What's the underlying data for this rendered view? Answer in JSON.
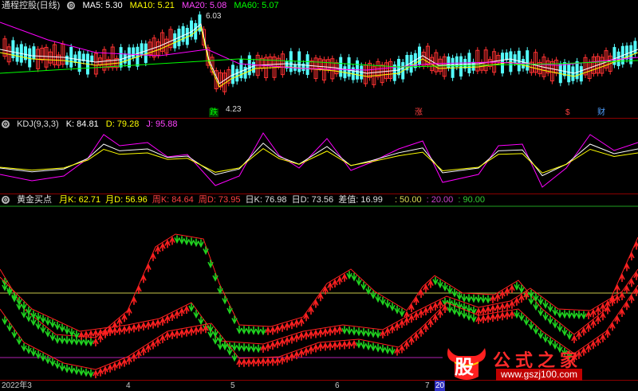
{
  "header_main": {
    "title": "通程控股(日线)",
    "ma5": "MA5: 5.30",
    "ma10": "MA10: 5.21",
    "ma20": "MA20: 5.08",
    "ma60": "MA60: 5.07"
  },
  "header_kdj": {
    "name": "KDJ(9,3,3)",
    "k": "K: 84.81",
    "d": "D: 79.28",
    "j": "J: 95.88"
  },
  "header_gold": {
    "name": "黄金买点",
    "mk": "月K: 62.71",
    "md": "月D: 56.96",
    "wk": "周K: 84.64",
    "wd": "周D: 73.95",
    "dk": "日K: 76.98",
    "dd": "日D: 73.56",
    "diff": "差值: 16.99",
    "l50": ": 50.00",
    "l20": ": 20.00",
    "l90": ": 90.00"
  },
  "annotations": {
    "high": "6.03",
    "low": "4.23",
    "die": "跌",
    "zhang": "涨",
    "s": "$",
    "cai": "财"
  },
  "xaxis": {
    "d0": "2022年3",
    "d1": "4",
    "d2": "5",
    "d3": "6",
    "d4": "7",
    "d5": "20"
  },
  "watermark": {
    "logo": "股",
    "title": "公式之家",
    "url": "www.gszj100.com"
  },
  "colors": {
    "ma5": "#ffffff",
    "ma10": "#ffff00",
    "ma20": "#ff00ff",
    "ma60": "#00ff00",
    "up": "#ff3232",
    "down": "#54fcfc",
    "buy": "#ff2020",
    "sell": "#20d020",
    "line50": "#c8c84a",
    "line20": "#b020b0",
    "line90": "#20a020"
  }
}
